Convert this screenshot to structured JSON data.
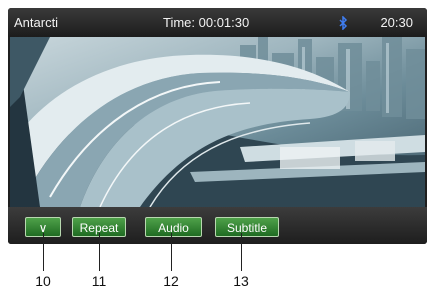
{
  "status": {
    "source": "Antarcti",
    "time_text": "Time: 00:01:30",
    "clock": "20:30"
  },
  "controls": {
    "collapse_label": "∨",
    "repeat_label": "Repeat",
    "audio_label": "Audio",
    "subtitle_label": "Subtitle"
  },
  "callouts": [
    "10",
    "11",
    "12",
    "13"
  ],
  "icons": {
    "bluetooth": "bluetooth-icon"
  },
  "colors": {
    "button_green": "#2f7d2f",
    "bar_dark": "#1f1f1f",
    "bluetooth_blue": "#2e6fe0"
  }
}
